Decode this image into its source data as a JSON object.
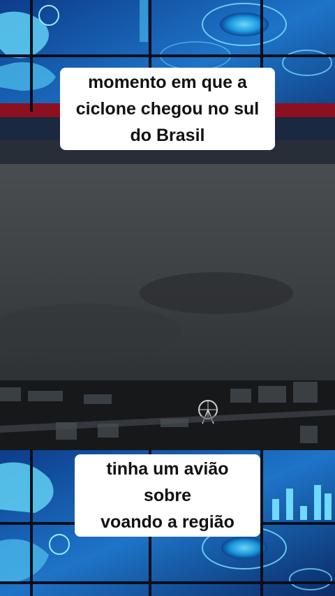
{
  "captions": {
    "top": "momento em que a\nciclone chegou no sul\ndo Brasil",
    "bottom": "tinha um avião sobre\nvoando a região"
  },
  "colors": {
    "panel_blue": "#1e74c8",
    "panel_dark": "#0a1f4a",
    "grid_line": "#0b0f1a",
    "accent_red": "#8c1020",
    "caption_bg": "#ffffff"
  },
  "icons": [
    "world-map-panel",
    "radar-panel",
    "bar-chart-panel",
    "ferris-wheel"
  ]
}
